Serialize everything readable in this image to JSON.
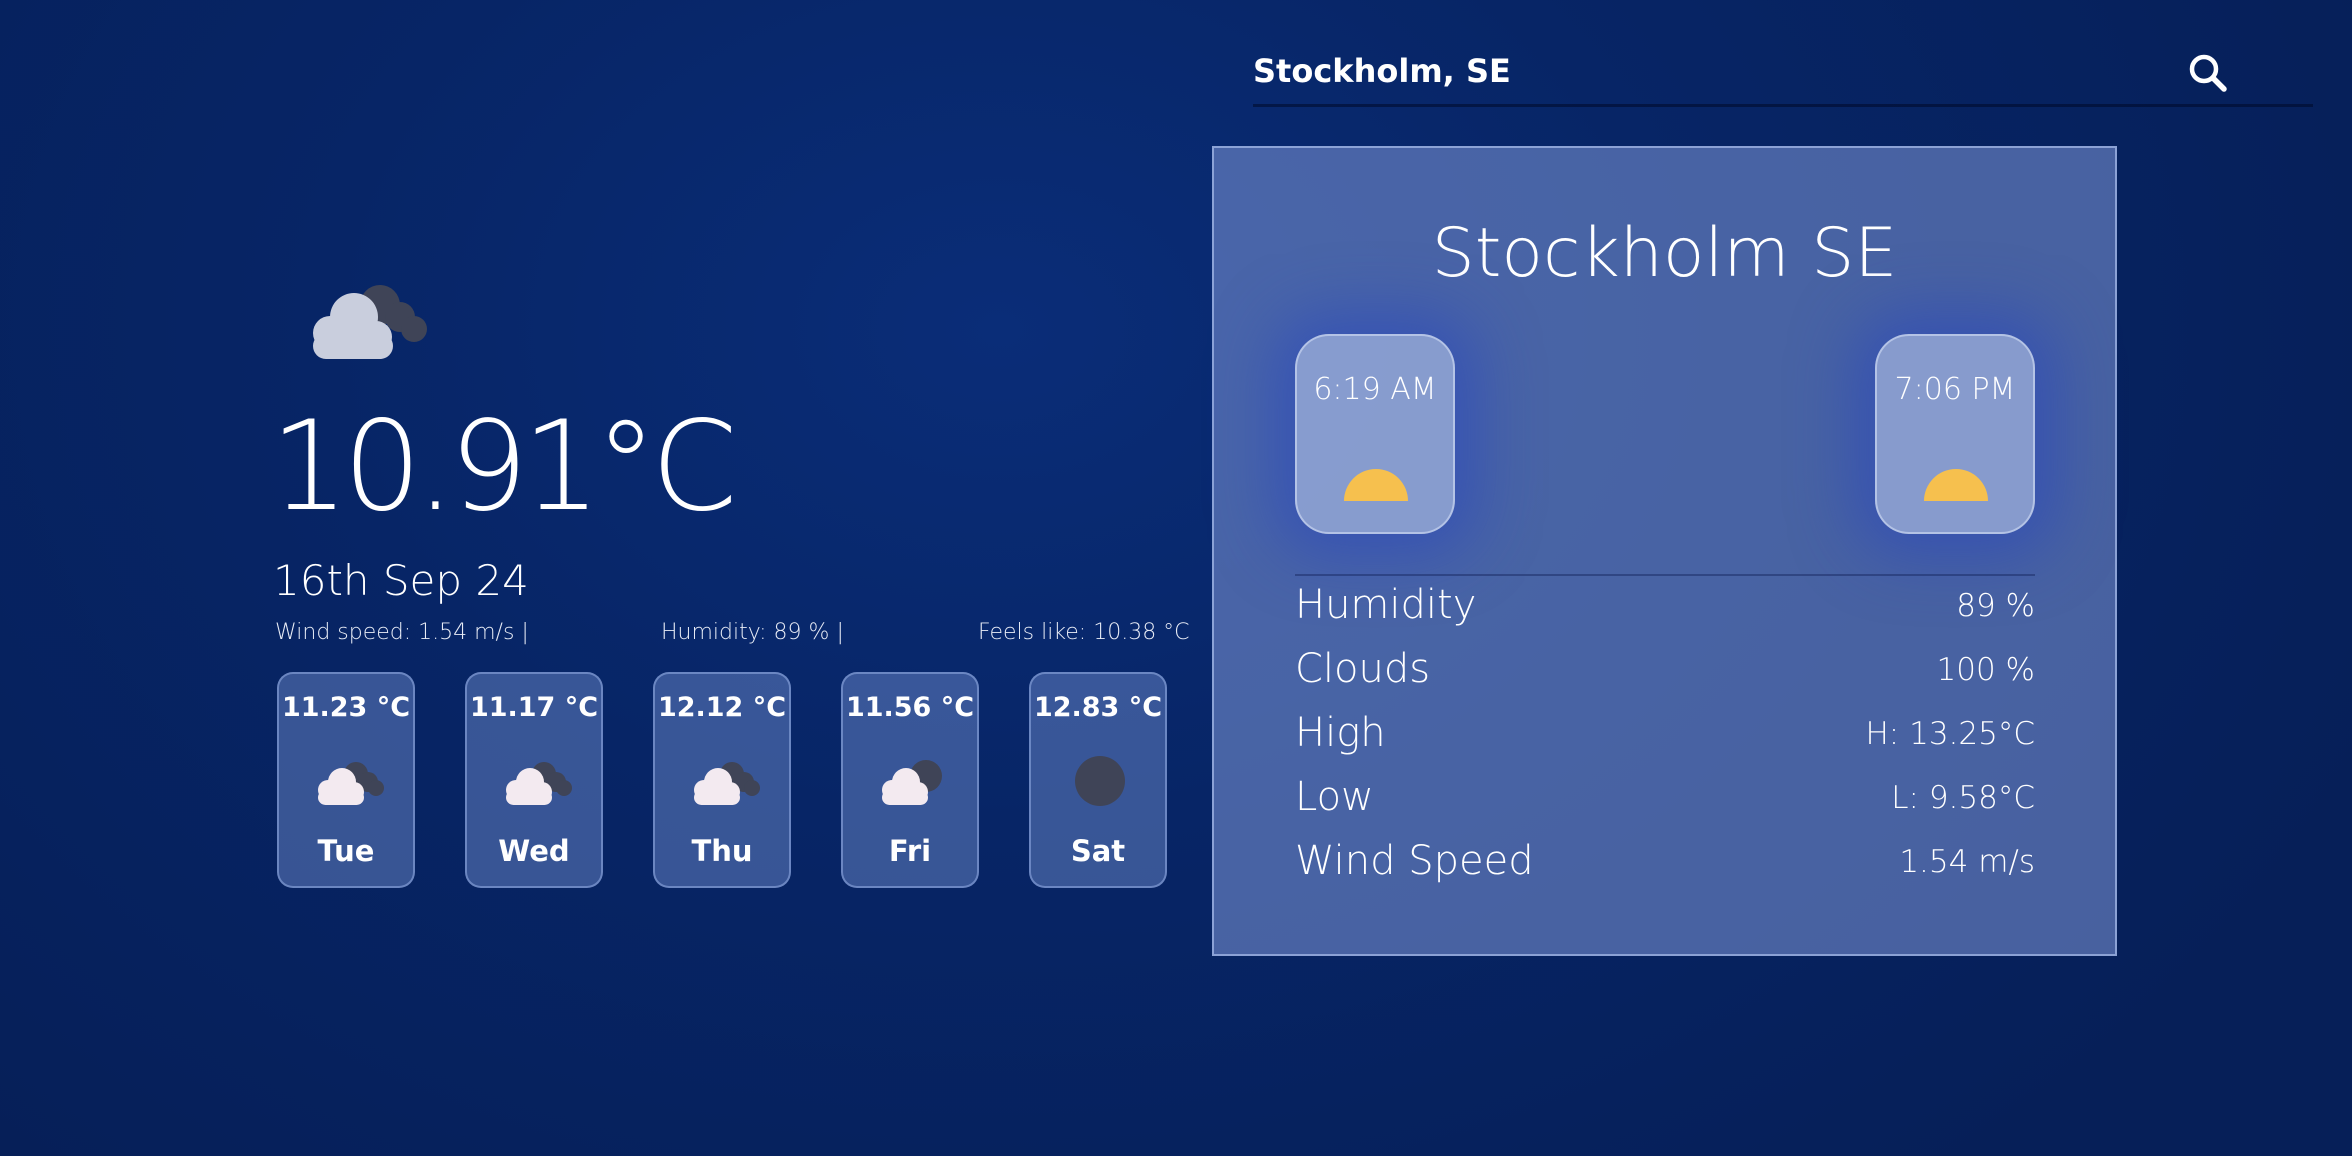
{
  "search": {
    "value": "Stockholm, SE",
    "icon": "search-icon"
  },
  "current": {
    "icon": "partly-cloudy-icon",
    "temperature": "10.91°C",
    "date": "16th Sep 24",
    "wind_speed": "Wind speed: 1.54 m/s  |",
    "humidity": "Humidity: 89 %  |",
    "feels_like": "Feels like: 10.38 °C"
  },
  "forecast": [
    {
      "temp": "11.23 °C",
      "day": "Tue",
      "icon": "cloudy-icon"
    },
    {
      "temp": "11.17 °C",
      "day": "Wed",
      "icon": "cloudy-icon"
    },
    {
      "temp": "12.12 °C",
      "day": "Thu",
      "icon": "cloudy-icon"
    },
    {
      "temp": "11.56 °C",
      "day": "Fri",
      "icon": "partly-cloudy-night-icon"
    },
    {
      "temp": "12.83 °C",
      "day": "Sat",
      "icon": "clear-night-icon"
    }
  ],
  "panel": {
    "city": "Stockholm SE",
    "sunrise": "6:19 AM",
    "sunset": "7:06 PM",
    "details": [
      {
        "label": "Humidity",
        "value": "89 %"
      },
      {
        "label": "Clouds",
        "value": "100 %"
      },
      {
        "label": "High",
        "value": "H: 13.25°C"
      },
      {
        "label": "Low",
        "value": "L: 9.58°C"
      },
      {
        "label": "Wind Speed",
        "value": "1.54 m/s"
      }
    ]
  },
  "colors": {
    "background": "#072566",
    "panel": "#5a73b8",
    "sun": "#f6c04e",
    "cloud_front": "#f3eaf0",
    "cloud_back": "#3f4457"
  }
}
